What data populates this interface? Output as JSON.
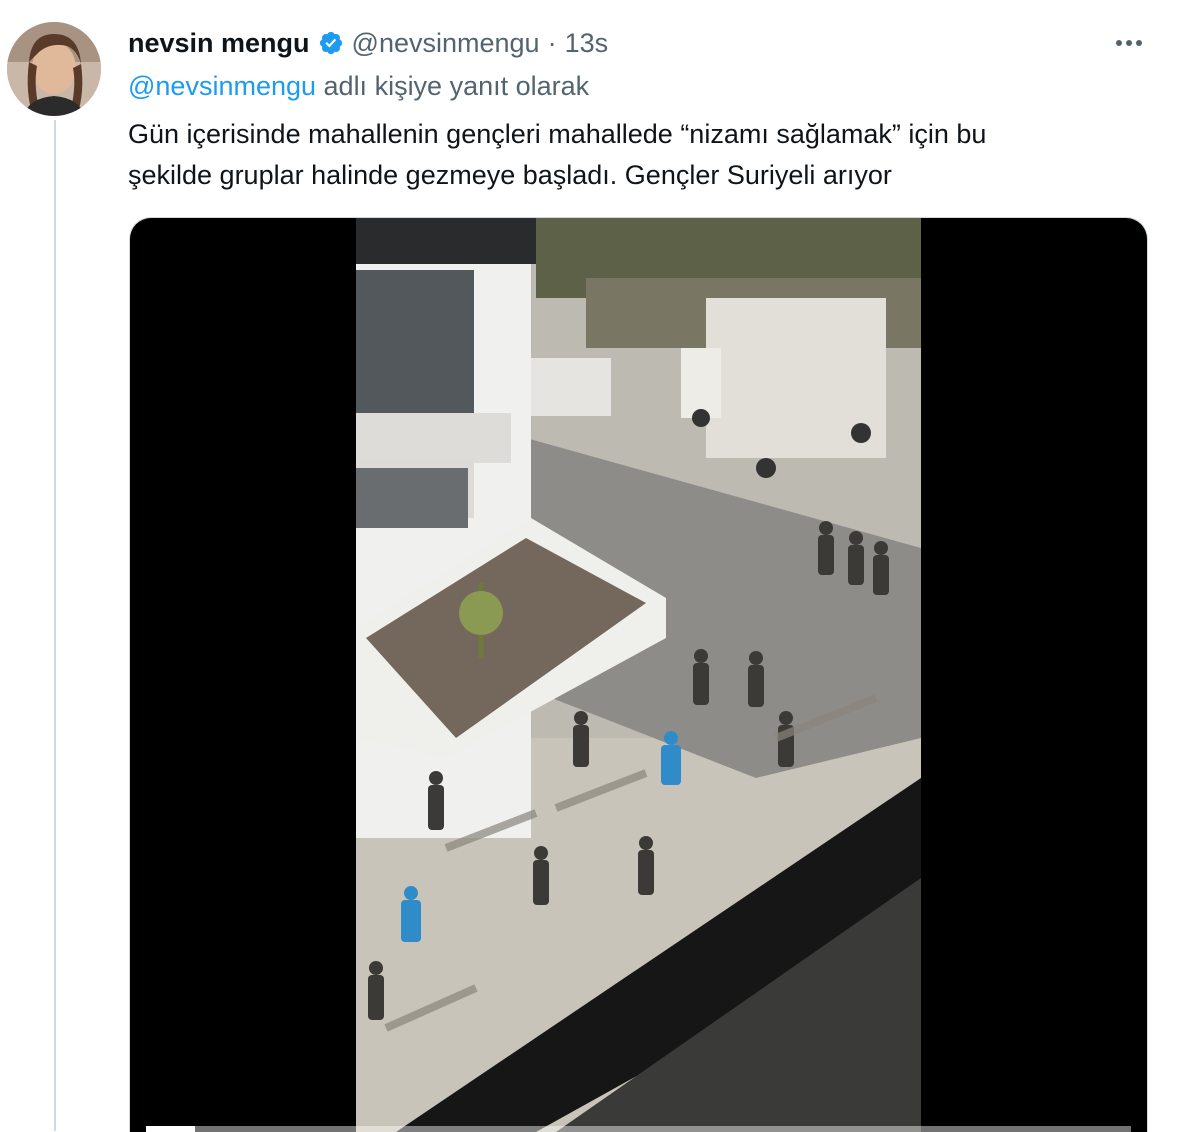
{
  "tweet": {
    "author_name": "nevsin mengu",
    "author_handle": "@nevsinmengu",
    "separator": "·",
    "time": "13s",
    "verified": true,
    "reply_to_handle": "@nevsinmengu",
    "reply_suffix": "adlı kişiye yanıt olarak",
    "text_line1": "Gün içerisinde mahallenin gençleri mahallede “nizamı sağlamak” için bu",
    "text_line2": "şekilde gruplar halinde gezmeye başladı. Gençler Suriyeli arıyor"
  },
  "icons": {
    "verified": "verified-badge-icon",
    "more": "more-horizontal-icon"
  },
  "media": {
    "type": "video",
    "progress": 0.05
  },
  "colors": {
    "accent": "#1d9bf0",
    "secondary_text": "#536471",
    "primary_text": "#0f1419"
  }
}
